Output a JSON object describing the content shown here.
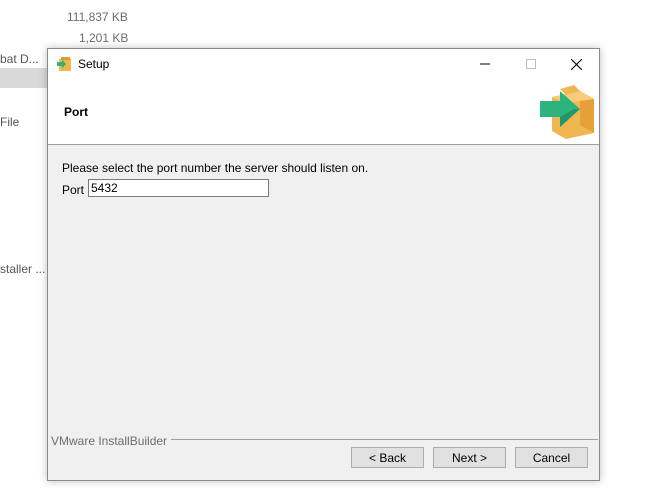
{
  "background_explorer": {
    "items": [
      {
        "size": "111,837 KB"
      },
      {
        "size": "1,201 KB"
      }
    ],
    "truncated_names": [
      "bat D...",
      "File",
      "staller ..."
    ]
  },
  "dialog": {
    "title": "Setup",
    "header_title": "Port",
    "instruction": "Please select the port number the server should listen on.",
    "port_label": "Port",
    "port_value": "5432",
    "brand": "VMware InstallBuilder",
    "buttons": {
      "back": "< Back",
      "next": "Next >",
      "cancel": "Cancel"
    },
    "icons": {
      "app": "installer-box-icon",
      "logo": "installer-box-arrow-icon",
      "minimize": "minimize-icon",
      "maximize": "maximize-icon",
      "close": "close-icon"
    }
  },
  "colors": {
    "dialog_bg": "#f0f0f0",
    "header_bg": "#ffffff",
    "button_bg": "#e1e1e1",
    "logo_box": "#f0b650",
    "logo_arrow": "#2db37c"
  }
}
